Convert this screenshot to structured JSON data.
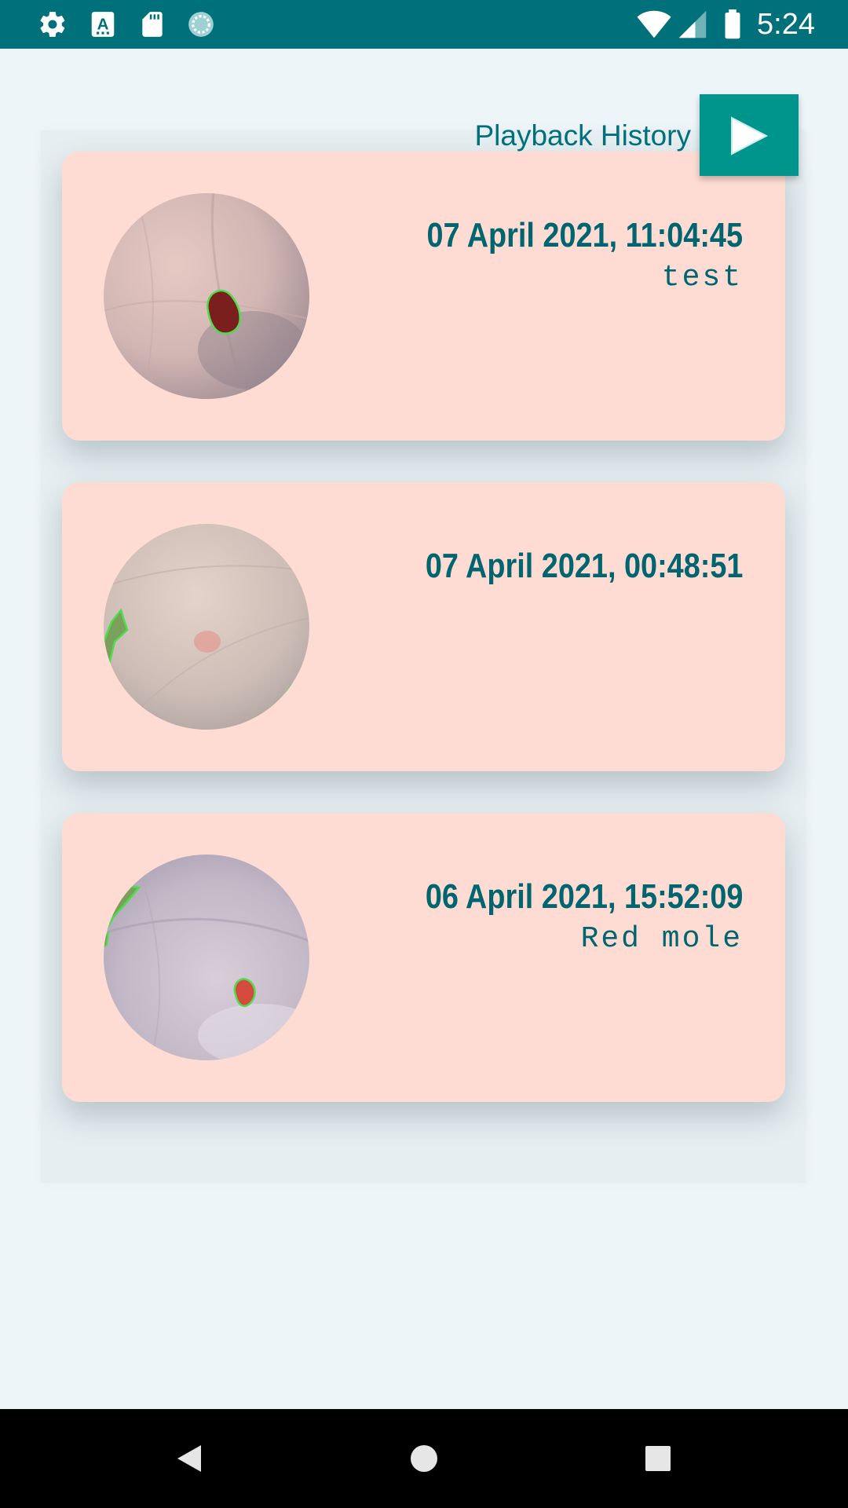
{
  "status_bar": {
    "time": "5:24",
    "icons": [
      "gear-icon",
      "keyboard-a-icon",
      "sd-card-icon",
      "sync-circle-icon",
      "wifi-icon",
      "signal-icon",
      "battery-icon"
    ]
  },
  "header": {
    "playback_label": "Playback History",
    "play_icon": "play-icon"
  },
  "records": [
    {
      "date": "07 April 2021, 11:04:45",
      "note": "test"
    },
    {
      "date": "07 April 2021, 00:48:51",
      "note": ""
    },
    {
      "date": "06 April 2021, 15:52:09",
      "note": "Red mole"
    }
  ],
  "nav_bar": {
    "icons": [
      "back-icon",
      "home-icon",
      "recents-icon"
    ]
  },
  "colors": {
    "status_bar": "#00707a",
    "accent": "#00958c",
    "card_background": "#fedcd3",
    "text_primary": "#00656e",
    "page_background": "#eef5f8"
  }
}
